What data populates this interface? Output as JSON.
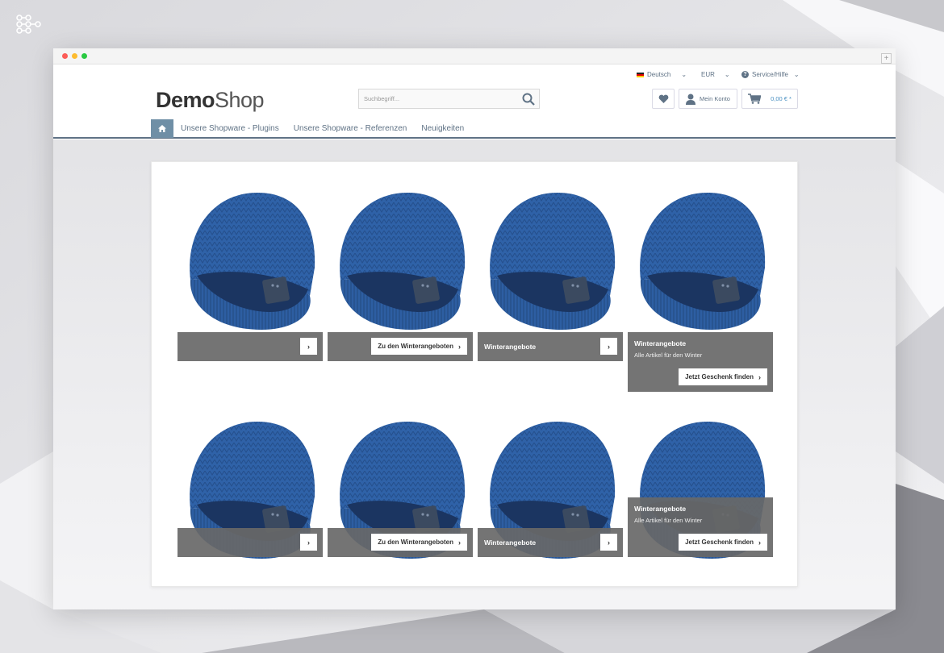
{
  "colors": {
    "accent": "#5f7285",
    "home_button": "#6f8fa6",
    "banner": "#686868",
    "hat": "#2e5fa6"
  },
  "topbar": {
    "language": "Deutsch",
    "currency": "EUR",
    "service": "Service/Hilfe"
  },
  "brand": {
    "bold": "Demo",
    "light": "Shop"
  },
  "search": {
    "placeholder": "Suchbegriff..."
  },
  "header_actions": {
    "account": "Mein Konto",
    "cart_total": "0,00 € *"
  },
  "nav": {
    "items": [
      "Unsere Shopware - Plugins",
      "Unsere Shopware - Referenzen",
      "Neuigkeiten"
    ]
  },
  "tiles": {
    "row1": [
      {
        "button": ""
      },
      {
        "button": "Zu den Winterangeboten"
      },
      {
        "title": "Winterangebote",
        "button": ""
      },
      {
        "title": "Winterangebote",
        "subtitle": "Alle Artikel für den Winter",
        "button": "Jetzt Geschenk finden"
      }
    ],
    "row2": [
      {
        "button": ""
      },
      {
        "button": "Zu den Winterangeboten"
      },
      {
        "title": "Winterangebote",
        "button": ""
      },
      {
        "title": "Winterangebote",
        "subtitle": "Alle Artikel für den Winter",
        "button": "Jetzt Geschenk finden"
      }
    ]
  }
}
